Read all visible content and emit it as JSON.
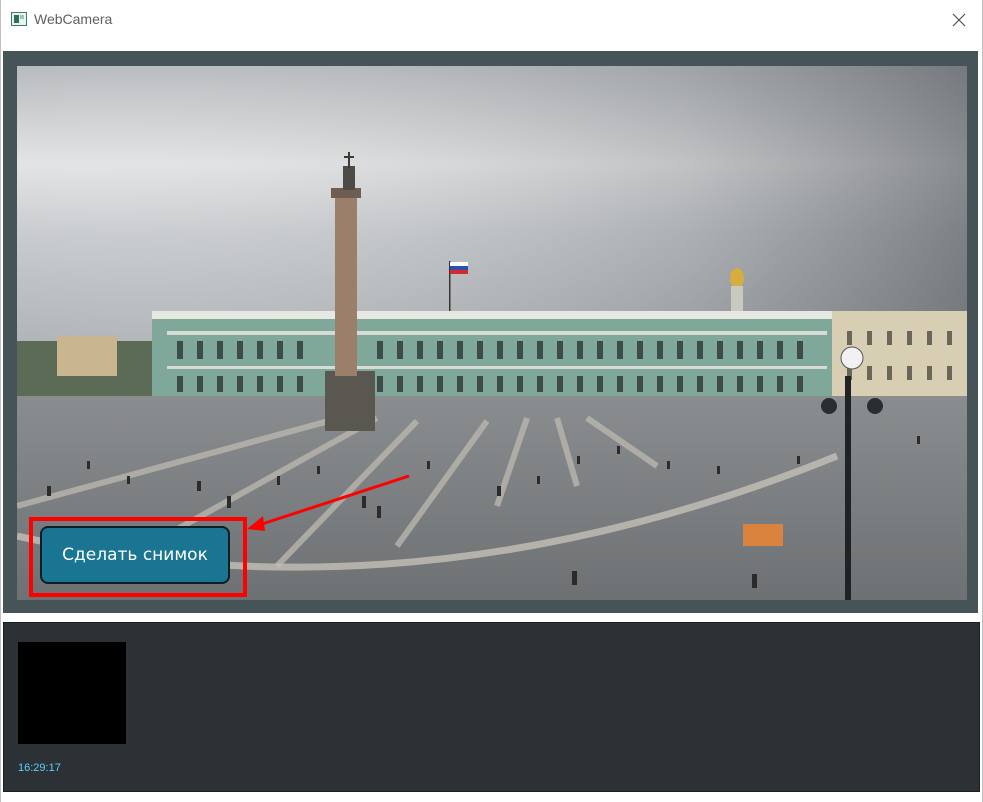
{
  "window": {
    "title": "WebCamera",
    "icon": "webcamera-app-icon",
    "close_icon": "close-icon"
  },
  "camera": {
    "feed_description_icon": "live-camera-feed",
    "snapshot_button_label": "Сделать снимок",
    "highlight_color": "#ff0000",
    "button_color": "#1a7593"
  },
  "gallery": {
    "snapshots": [
      {
        "time": "16:29:17"
      }
    ]
  },
  "colors": {
    "panel_bg": "#465457",
    "gallery_bg": "#2b3134",
    "time_text": "#5ad0ff"
  }
}
